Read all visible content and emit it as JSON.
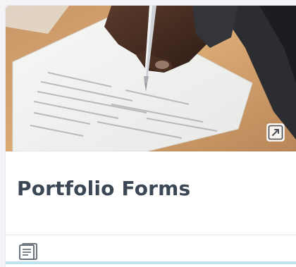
{
  "card": {
    "title": "Portfolio Forms",
    "image_subject": "hand-signing-document-photo",
    "expand_icon": "expand-icon",
    "footer_icon": "forms-icon"
  },
  "colors": {
    "title_text": "#3b4754",
    "accent_bar": "#bfe3ef",
    "icon_gray": "#5c6670"
  }
}
